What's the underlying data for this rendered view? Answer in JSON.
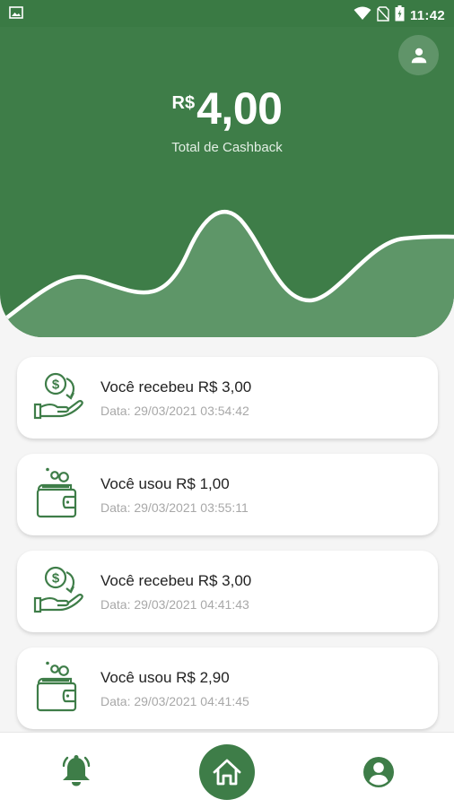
{
  "status_bar": {
    "time": "11:42",
    "icons": [
      "image-icon",
      "wifi-icon",
      "no-sim-icon",
      "battery-icon"
    ]
  },
  "header": {
    "currency": "R$",
    "amount": "4,00",
    "subtitle": "Total de Cashback",
    "profile_icon": "person-icon"
  },
  "transactions": [
    {
      "type": "received",
      "icon": "cashback-received-icon",
      "title": "Você recebeu R$ 3,00",
      "date": "Data: 29/03/2021 03:54:42"
    },
    {
      "type": "used",
      "icon": "wallet-coins-icon",
      "title": "Você usou R$ 1,00",
      "date": "Data: 29/03/2021 03:55:11"
    },
    {
      "type": "received",
      "icon": "cashback-received-icon",
      "title": "Você recebeu R$ 3,00",
      "date": "Data: 29/03/2021 04:41:43"
    },
    {
      "type": "used",
      "icon": "wallet-coins-icon",
      "title": "Você usou R$ 2,90",
      "date": "Data: 29/03/2021 04:41:45"
    }
  ],
  "bottom_nav": {
    "items": [
      {
        "icon": "bell-icon"
      },
      {
        "icon": "home-icon",
        "active": true
      },
      {
        "icon": "account-icon"
      }
    ]
  },
  "colors": {
    "primary": "#3e7d48",
    "status_bar": "#3a7a44",
    "background": "#f5f5f5",
    "card": "#ffffff",
    "date_text": "#a8a8a8"
  }
}
